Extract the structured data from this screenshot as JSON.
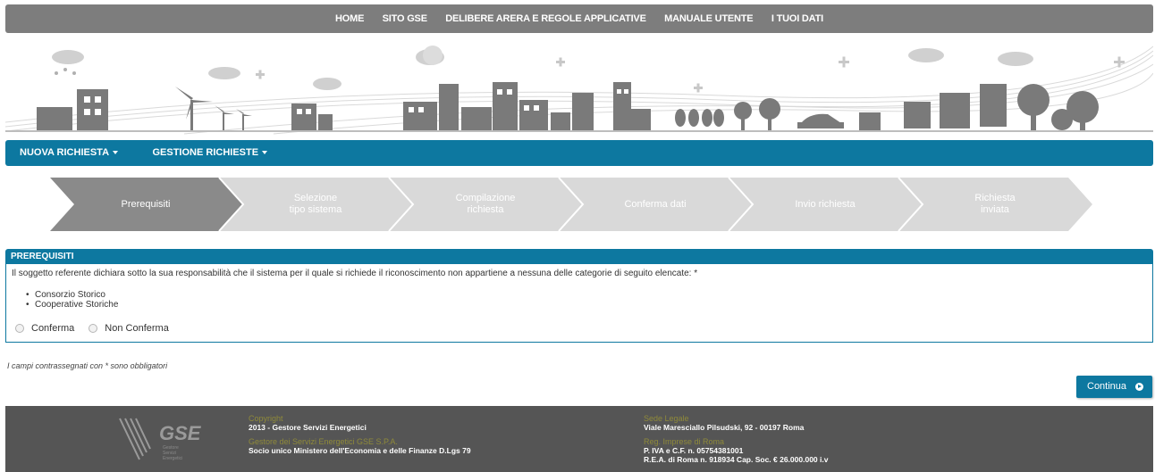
{
  "topnav": {
    "items": [
      "HOME",
      "SITO GSE",
      "DELIBERE ARERA E REGOLE APPLICATIVE",
      "MANUALE UTENTE",
      "I TUOI DATI"
    ]
  },
  "menu": {
    "items": [
      "NUOVA RICHIESTA",
      "GESTIONE RICHIESTE"
    ]
  },
  "wizard": {
    "steps": [
      {
        "line1": "Prerequisiti",
        "line2": "",
        "active": true
      },
      {
        "line1": "Selezione",
        "line2": "tipo sistema",
        "active": false
      },
      {
        "line1": "Compilazione",
        "line2": "richiesta",
        "active": false
      },
      {
        "line1": "Conferma dati",
        "line2": "",
        "active": false
      },
      {
        "line1": "Invio richiesta",
        "line2": "",
        "active": false
      },
      {
        "line1": "Richiesta",
        "line2": "inviata",
        "active": false
      }
    ]
  },
  "section": {
    "title": "PREREQUISITI",
    "question": "Il soggetto referente dichiara sotto la sua responsabilità che il sistema per il quale si richiede il riconoscimento non appartiene a nessuna delle categorie di seguito elencate: *",
    "bullets": [
      "Consorzio Storico",
      "Cooperative Storiche"
    ],
    "radio_options": [
      "Conferma",
      "Non Conferma"
    ]
  },
  "note": "I campi contrassegnati con * sono obbligatori",
  "continue_label": "Continua",
  "footer": {
    "logo_text": "GSE",
    "logo_sub": "Gestore\nServizi\nEnergetici",
    "copyright_label": "Copyright",
    "copyright_value": "2013 - Gestore Servizi Energetici",
    "company_label": "Gestore dei Servizi Energetici GSE S.P.A.",
    "company_value": "Socio unico Ministero dell'Economia e delle Finanze D.Lgs 79",
    "seat_label": "Sede Legale",
    "seat_value": "Viale Maresciallo Pilsudski, 92 - 00197 Roma",
    "reg_label": "Reg. Imprese di Roma",
    "reg_value1": "P. IVA e C.F. n. 05754381001",
    "reg_value2": "R.E.A. di Roma n. 918934 Cap. Soc. € 26.000.000 i.v"
  },
  "colors": {
    "primary": "#0d78a0",
    "topnav": "#7d7d7d",
    "step_active": "#8a8a8a",
    "step_inactive": "#d9d9d9",
    "footer": "#555555"
  }
}
